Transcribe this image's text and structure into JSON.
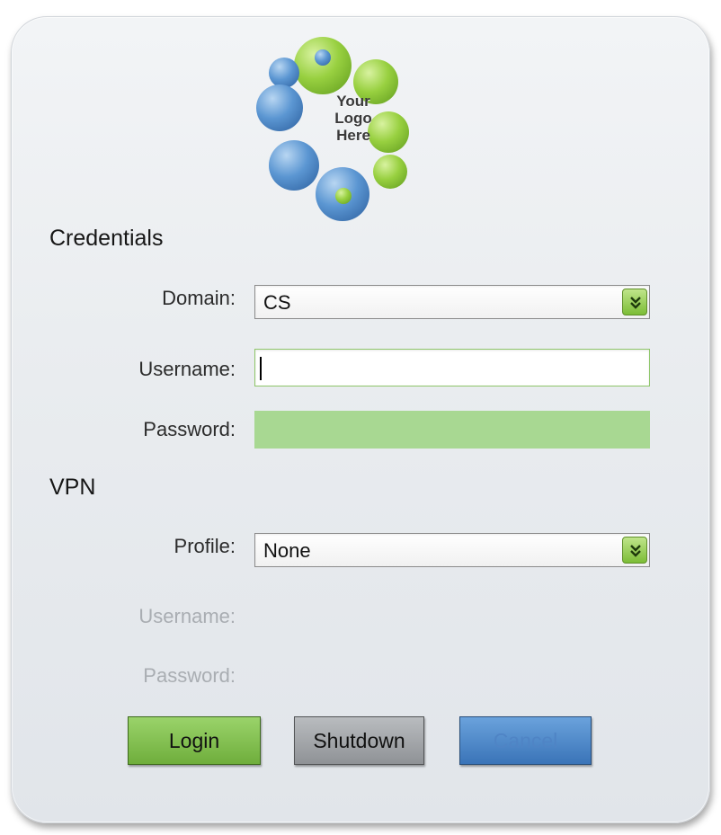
{
  "logo": {
    "line1": "Your",
    "line2": "Logo",
    "line3": "Here"
  },
  "credentials": {
    "title": "Credentials",
    "domain_label": "Domain:",
    "domain_value": "CS",
    "username_label": "Username:",
    "username_value": "",
    "password_label": "Password:"
  },
  "vpn": {
    "title": "VPN",
    "profile_label": "Profile:",
    "profile_value": "None",
    "username_label": "Username:",
    "password_label": "Password:"
  },
  "buttons": {
    "login": "Login",
    "shutdown": "Shutdown",
    "cancel": "Cancel"
  },
  "colors": {
    "accent_green": "#7cbd36",
    "accent_blue": "#3a74b8",
    "neutral_gray": "#8f9296"
  }
}
